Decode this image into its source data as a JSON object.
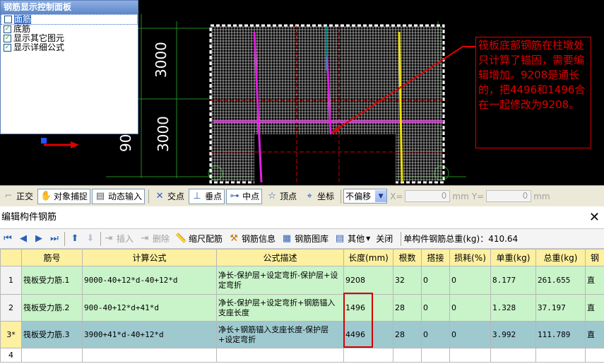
{
  "panel": {
    "title": "钢筋显示控制面板",
    "items": [
      {
        "label": "面筋",
        "checked": false,
        "selected": true
      },
      {
        "label": "底筋",
        "checked": true,
        "selected": false
      },
      {
        "label": "显示其它图元",
        "checked": true,
        "selected": false
      },
      {
        "label": "显示详细公式",
        "checked": true,
        "selected": false
      }
    ]
  },
  "cad": {
    "dims": [
      "3000",
      "3000",
      "90"
    ],
    "annotation": "筏板底部钢筋在柱墩处只计算了锚固，需要编辑增加。9208是通长的，把4496和1496合在一起修改为9208。",
    "colors": {
      "grid": "#ffffff",
      "magenta": "#e020e0",
      "yellow": "#f0e000",
      "red": "#d00000",
      "green": "#1e8c1e"
    }
  },
  "snapbar": {
    "items": [
      {
        "label": "正交",
        "icon": "ortho-icon",
        "on": false
      },
      {
        "label": "对象捕捉",
        "icon": "object-snap-icon",
        "on": true
      },
      {
        "label": "动态输入",
        "icon": "dynamic-input-icon",
        "on": true
      },
      {
        "label": "交点",
        "icon": "intersection-icon",
        "on": false
      },
      {
        "label": "垂点",
        "icon": "perpendicular-icon",
        "on": true
      },
      {
        "label": "中点",
        "icon": "midpoint-icon",
        "on": true
      },
      {
        "label": "顶点",
        "icon": "vertex-icon",
        "on": false
      },
      {
        "label": "坐标",
        "icon": "coordinate-icon",
        "on": false
      }
    ],
    "offset_select": "不偏移",
    "x_label": "X=",
    "x_value": "0",
    "y_label": "Y=",
    "y_value": "0",
    "unit": "mm"
  },
  "editor": {
    "title": "编辑构件钢筋",
    "tools": {
      "insert": "插入",
      "delete": "删除",
      "scale": "缩尺配筋",
      "info": "钢筋信息",
      "library": "钢筋图库",
      "other": "其他",
      "close": "关闭",
      "total": "单构件钢筋总重(kg)：410.64"
    },
    "columns": [
      "筋号",
      "计算公式",
      "公式描述",
      "长度(mm)",
      "根数",
      "搭接",
      "损耗(%)",
      "单重(kg)",
      "总重(kg)",
      "钢"
    ],
    "rows": [
      {
        "num": "1",
        "name": "筏板受力筋.1",
        "formula": "9000-40+12*d-40+12*d",
        "desc": "净长-保护层+设定弯折-保护层+设定弯折",
        "length": "9208",
        "count": "32",
        "lap": "0",
        "loss": "0",
        "unit_w": "8.177",
        "total_w": "261.655",
        "type": "直"
      },
      {
        "num": "2",
        "name": "筏板受力筋.2",
        "formula": "900-40+12*d+41*d",
        "desc": "净长-保护层+设定弯折+钢筋锚入支座长度",
        "length": "1496",
        "count": "28",
        "lap": "0",
        "loss": "0",
        "unit_w": "1.328",
        "total_w": "37.197",
        "type": "直"
      },
      {
        "num": "3*",
        "name": "筏板受力筋.3",
        "formula": "3900+41*d-40+12*d",
        "desc": "净长+钢筋锚入支座长度-保护层+设定弯折",
        "length": "4496",
        "count": "28",
        "lap": "0",
        "loss": "0",
        "unit_w": "3.992",
        "total_w": "111.789",
        "type": "直"
      },
      {
        "num": "4",
        "name": "",
        "formula": "",
        "desc": "",
        "length": "",
        "count": "",
        "lap": "",
        "loss": "",
        "unit_w": "",
        "total_w": "",
        "type": ""
      }
    ]
  }
}
